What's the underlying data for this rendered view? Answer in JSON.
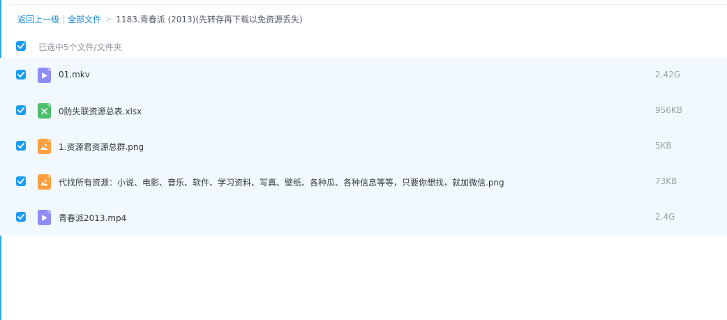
{
  "breadcrumb": {
    "back_label": "返回上一级",
    "separator": "|",
    "all_files_label": "全部文件",
    "arrow": ">",
    "current_folder": "1183.青春派 (2013)(先转存再下载以免资源丢失)"
  },
  "selection": {
    "label": "已选中5个文件/文件夹",
    "checked": true
  },
  "files": [
    {
      "name": "01.mkv",
      "size": "2.42G",
      "type": "video",
      "checked": true
    },
    {
      "name": "0防失联资源总表.xlsx",
      "size": "956KB",
      "type": "excel",
      "checked": true
    },
    {
      "name": "1.资源君资源总群.png",
      "size": "5KB",
      "type": "image",
      "checked": true
    },
    {
      "name": "代找所有资源：小说、电影、音乐、软件、学习资料、写真、壁纸、各种瓜、各种信息等等，只要你想找，就加微信.png",
      "size": "73KB",
      "type": "image",
      "checked": true
    },
    {
      "name": "青春派2013.mp4",
      "size": "2.4G",
      "type": "video",
      "checked": true
    }
  ],
  "colors": {
    "accent": "#1a9df0",
    "link": "#1a8bd8",
    "selected_row_bg": "#f1f8fe",
    "video_icon": "#8e8cf5",
    "excel_icon": "#4cc06a",
    "image_icon": "#ff9f40"
  },
  "icons": {
    "video": "play-icon",
    "excel": "excel-x-icon",
    "image": "image-icon",
    "checkbox": "checkmark-icon"
  }
}
